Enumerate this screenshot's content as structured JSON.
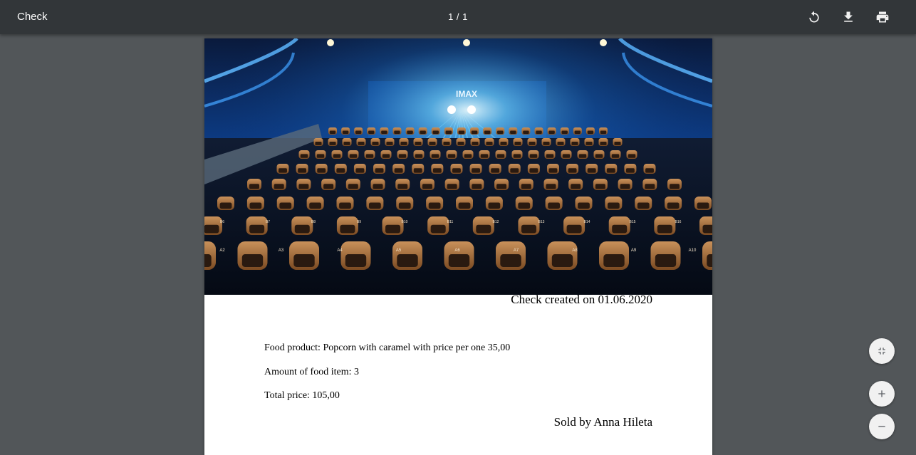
{
  "toolbar": {
    "title": "Check",
    "page_counter": "1 / 1",
    "icons": [
      "rotate-icon",
      "download-icon",
      "print-icon"
    ]
  },
  "document": {
    "hero_screen_text": "IMAX",
    "front_row_seat_labels": [
      "A2",
      "A3",
      "A4",
      "A5",
      "A6",
      "A7",
      "A8",
      "A9",
      "A10"
    ],
    "second_row_seat_labels": [
      "B6",
      "B7",
      "B8",
      "B9",
      "B10",
      "B11",
      "B12",
      "B13",
      "B14",
      "B15",
      "B16"
    ],
    "created_line": "Check created on 01.06.2020",
    "food_product_line": "Food product: Popcorn with caramel with price per one 35,00",
    "amount_line": "Amount of food item: 3",
    "total_line": "Total price: 105,00",
    "sold_by_line": "Sold by Anna Hileta"
  },
  "zoom_controls": {
    "icons": [
      "fit-to-page-icon",
      "zoom-in-icon",
      "zoom-out-icon"
    ]
  },
  "colors": {
    "toolbar_bg": "#323639",
    "viewer_bg": "#525659",
    "seat_color": "#b07840",
    "theatre_blue": "#0d3f8c"
  }
}
